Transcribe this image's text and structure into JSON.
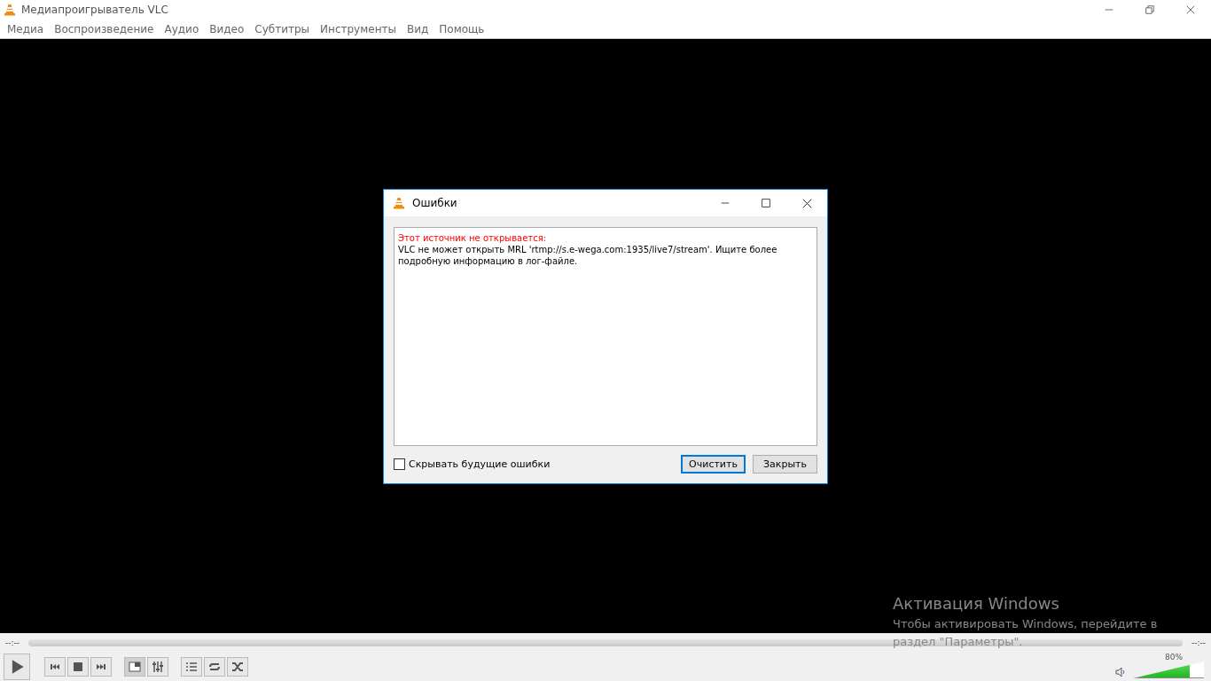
{
  "window": {
    "title": "Медиапроигрыватель VLC"
  },
  "menu": [
    "Медиа",
    "Воспроизведение",
    "Аудио",
    "Видео",
    "Субтитры",
    "Инструменты",
    "Вид",
    "Помощь"
  ],
  "dialog": {
    "title": "Ошибки",
    "error_heading": "Этот источник не открывается:",
    "error_message": "VLC не может открыть MRL 'rtmp://s.e-wega.com:1935/live7/stream'. Ищите более подробную информацию в лог-файле.",
    "hide_future_errors": {
      "label": "Скрывать будущие ошибки",
      "checked": false
    },
    "buttons": [
      {
        "label": "Очистить",
        "focused": true
      },
      {
        "label": "Закрыть",
        "focused": false
      }
    ]
  },
  "activation_notice": {
    "title": "Активация Windows",
    "lines": [
      "Чтобы активировать Windows, перейдите в",
      "раздел \"Параметры\"."
    ]
  },
  "controls": {
    "elapsed": "--:--",
    "remaining": "--:--",
    "volume": {
      "reading": "80%",
      "level": 0.8
    }
  }
}
